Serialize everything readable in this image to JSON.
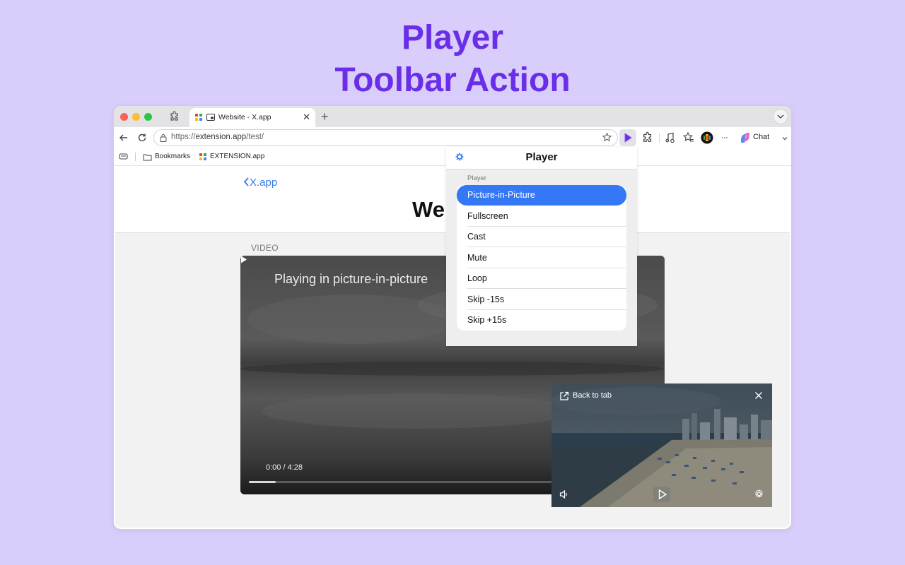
{
  "headline": {
    "line1": "Player",
    "line2": "Toolbar Action"
  },
  "browser": {
    "tab": {
      "title": "Website - X.app",
      "close_glyph": "✕"
    },
    "new_tab_glyph": "+",
    "url": {
      "scheme": "https://",
      "host": "extension.app",
      "path": "/test/"
    },
    "toolbar": {
      "chat_label": "Chat",
      "more_glyph": "···"
    },
    "bookmarks": {
      "folder_label": "Bookmarks",
      "site_label": "EXTENSION.app"
    },
    "colors": {
      "accent": "#3478f6",
      "extension_active": "#6a2ee8"
    }
  },
  "page": {
    "back_label": "X.app",
    "title_visible": "Wel",
    "video_label": "VIDEO",
    "video": {
      "message": "Playing in picture-in-picture",
      "time": "0:00 / 4:28",
      "progress": 0.066
    }
  },
  "popup": {
    "title": "Player",
    "section_label": "Player",
    "items": [
      {
        "label": "Picture-in-Picture",
        "selected": true
      },
      {
        "label": "Fullscreen"
      },
      {
        "label": "Cast"
      },
      {
        "label": "Mute"
      },
      {
        "label": "Loop"
      },
      {
        "label": "Skip -15s"
      },
      {
        "label": "Skip +15s"
      }
    ]
  },
  "pip": {
    "back_label": "Back to tab"
  }
}
